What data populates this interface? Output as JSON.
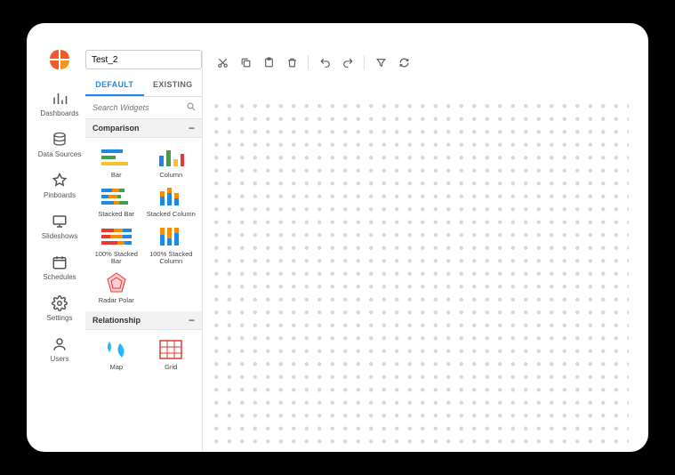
{
  "dashboard_name": "Test_2",
  "sidebar": {
    "items": [
      {
        "label": "Dashboards"
      },
      {
        "label": "Data Sources"
      },
      {
        "label": "Pinboards"
      },
      {
        "label": "Slideshows"
      },
      {
        "label": "Schedules"
      },
      {
        "label": "Settings"
      },
      {
        "label": "Users"
      }
    ]
  },
  "panel": {
    "tabs": {
      "default": "DEFAULT",
      "existing": "EXISTING"
    },
    "search_placeholder": "Search Widgets",
    "categories": [
      {
        "name": "Comparison",
        "widgets": [
          {
            "label": "Bar"
          },
          {
            "label": "Column"
          },
          {
            "label": "Stacked Bar"
          },
          {
            "label": "Stacked Column"
          },
          {
            "label": "100% Stacked Bar"
          },
          {
            "label": "100% Stacked Column"
          },
          {
            "label": "Radar Polar"
          }
        ]
      },
      {
        "name": "Relationship",
        "widgets": [
          {
            "label": "Map"
          },
          {
            "label": "Grid"
          }
        ]
      }
    ]
  },
  "toolbar": {
    "cut": "Cut",
    "copy": "Copy",
    "paste": "Paste",
    "delete": "Delete",
    "undo": "Undo",
    "redo": "Redo",
    "filter": "Filter",
    "refresh": "Refresh"
  }
}
